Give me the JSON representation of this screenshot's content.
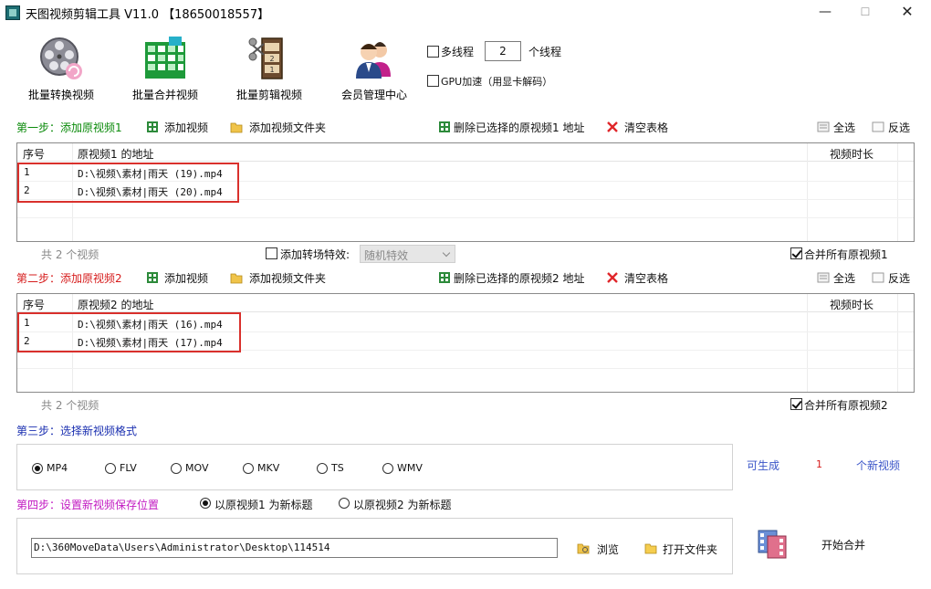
{
  "window": {
    "title": "天图视频剪辑工具 V11.0  【18650018557】",
    "minimize": "—",
    "maximize": "☐",
    "close": "✕"
  },
  "toolbar": {
    "buttons": [
      {
        "label": "批量转换视频",
        "icon": "film-reel-icon"
      },
      {
        "label": "批量合并视频",
        "icon": "merge-grid-icon"
      },
      {
        "label": "批量剪辑视频",
        "icon": "clapper-film-icon"
      },
      {
        "label": "会员管理中心",
        "icon": "members-icon"
      }
    ],
    "multithread_label": "多线程",
    "thread_count": "2",
    "thread_suffix": "个线程",
    "gpu_label": "GPU加速（用显卡解码）"
  },
  "step1": {
    "title": "第一步：添加原视频1",
    "add_video": "添加视频",
    "add_folder": "添加视频文件夹",
    "delete_selected": "删除已选择的原视频1 地址",
    "clear_table": "清空表格",
    "select_all": "全选",
    "invert": "反选",
    "columns": [
      "序号",
      "原视频1 的地址",
      "视频时长"
    ],
    "rows": [
      {
        "index": "1",
        "path": "D:\\视频\\素材|雨天 (19).mp4"
      },
      {
        "index": "2",
        "path": "D:\\视频\\素材|雨天 (20).mp4"
      }
    ],
    "count": "共 2 个视频",
    "transition_label": "添加转场特效:",
    "transition_value": "随机特效",
    "merge_all": "合并所有原视频1"
  },
  "step2": {
    "title": "第二步：添加原视频2",
    "add_video": "添加视频",
    "add_folder": "添加视频文件夹",
    "delete_selected": "删除已选择的原视频2 地址",
    "clear_table": "清空表格",
    "select_all": "全选",
    "invert": "反选",
    "columns": [
      "序号",
      "原视频2 的地址",
      "视频时长"
    ],
    "rows": [
      {
        "index": "1",
        "path": "D:\\视频\\素材|雨天 (16).mp4"
      },
      {
        "index": "2",
        "path": "D:\\视频\\素材|雨天 (17).mp4"
      }
    ],
    "count": "共 2 个视频",
    "merge_all": "合并所有原视频2"
  },
  "step3": {
    "title": "第三步：选择新视频格式",
    "formats": [
      "MP4",
      "FLV",
      "MOV",
      "MKV",
      "TS",
      "WMV"
    ],
    "selected_format": "MP4",
    "can_generate": "可生成",
    "generate_count": "1",
    "new_videos": "个新视频"
  },
  "step4": {
    "title": "第四步：设置新视频保存位置",
    "title_option1": "以原视频1 为新标题",
    "title_option2": "以原视频2 为新标题",
    "save_path": "D:\\360MoveData\\Users\\Administrator\\Desktop\\114514",
    "browse": "浏览",
    "open_folder": "打开文件夹",
    "start_merge": "开始合并"
  }
}
